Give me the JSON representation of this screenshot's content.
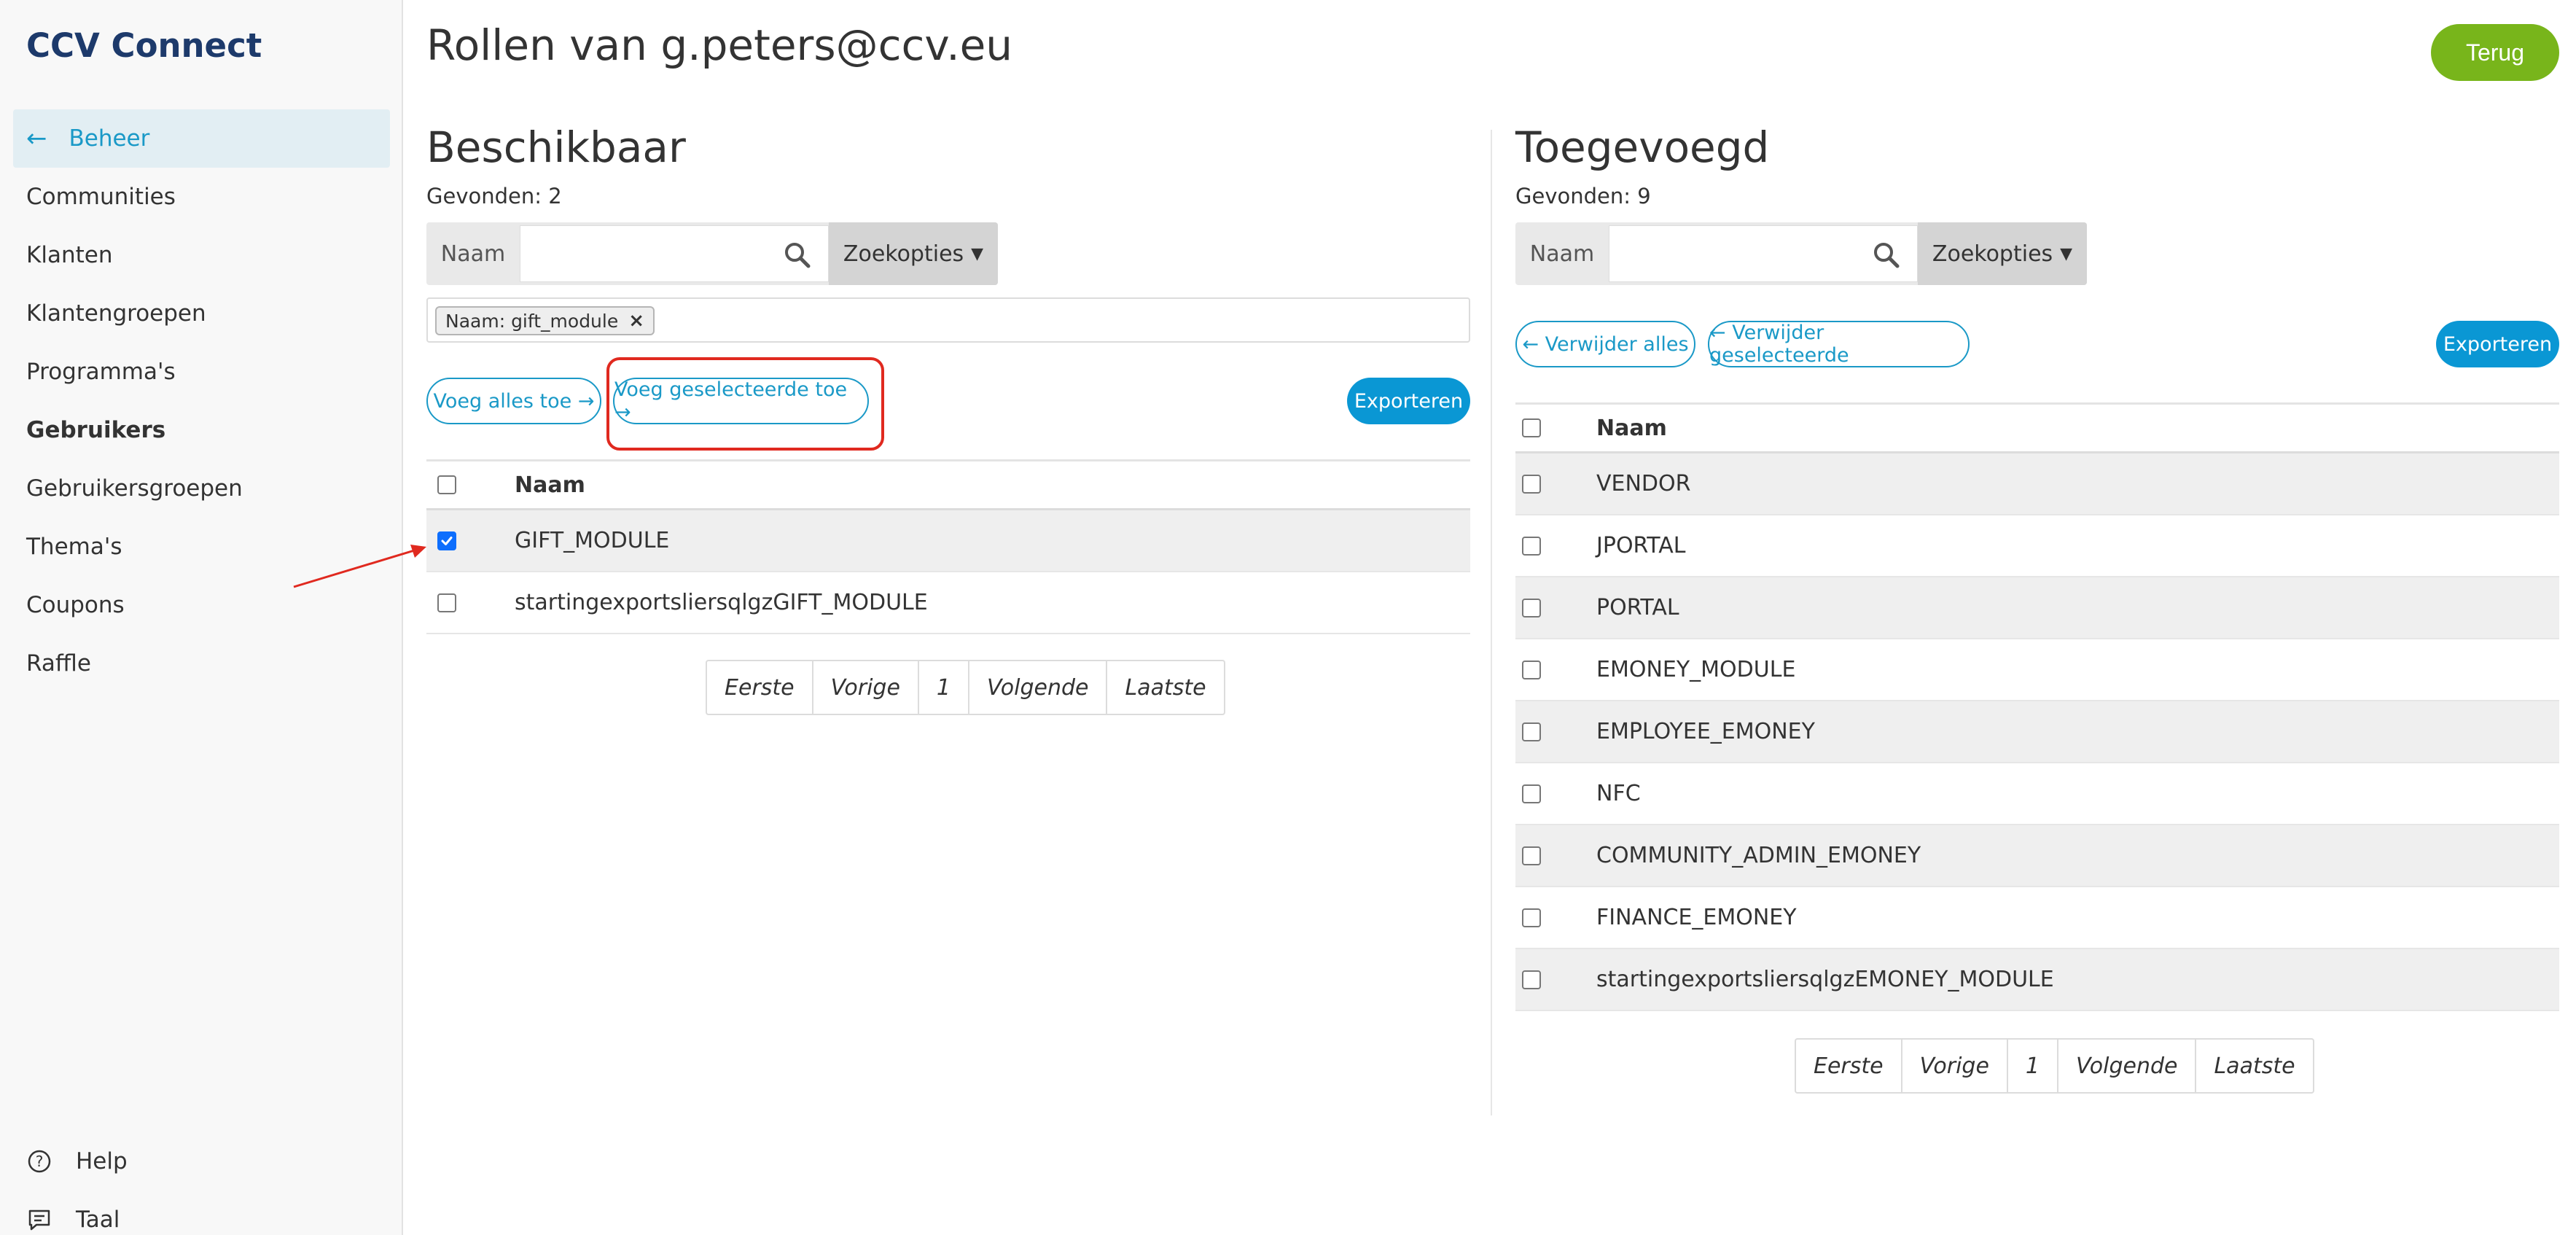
{
  "sidebar": {
    "brand": "CCV Connect",
    "active_item": "Beheer",
    "items": [
      "Communities",
      "Klanten",
      "Klantengroepen",
      "Programma's",
      "Gebruikers",
      "Gebruikersgroepen",
      "Thema's",
      "Coupons",
      "Raffle"
    ],
    "bold_item": "Gebruikers",
    "help": "Help",
    "language": "Taal"
  },
  "header": {
    "title": "Rollen van g.peters@ccv.eu",
    "back_label": "Terug"
  },
  "available": {
    "title": "Beschikbaar",
    "found": "Gevonden: 2",
    "search_label": "Naam",
    "search_placeholder": "",
    "search_options": "Zoekopties",
    "filter_chip": "Naam: gift_module",
    "add_all": "Voeg alles toe →",
    "add_selected": "Voeg geselecteerde toe →",
    "export": "Exporteren",
    "column": "Naam",
    "rows": [
      {
        "name": "GIFT_MODULE",
        "checked": true
      },
      {
        "name": "startingexportsliersqlgzGIFT_MODULE",
        "checked": false
      }
    ],
    "pager": [
      "Eerste",
      "Vorige",
      "1",
      "Volgende",
      "Laatste"
    ]
  },
  "added": {
    "title": "Toegevoegd",
    "found": "Gevonden: 9",
    "search_label": "Naam",
    "search_placeholder": "",
    "search_options": "Zoekopties",
    "remove_all": "← Verwijder alles",
    "remove_selected": "← Verwijder geselecteerde",
    "export": "Exporteren",
    "column": "Naam",
    "rows": [
      {
        "name": "VENDOR"
      },
      {
        "name": "JPORTAL"
      },
      {
        "name": "PORTAL"
      },
      {
        "name": "EMONEY_MODULE"
      },
      {
        "name": "EMPLOYEE_EMONEY"
      },
      {
        "name": "NFC"
      },
      {
        "name": "COMMUNITY_ADMIN_EMONEY"
      },
      {
        "name": "FINANCE_EMONEY"
      },
      {
        "name": "startingexportsliersqlgzEMONEY_MODULE"
      }
    ],
    "pager": [
      "Eerste",
      "Vorige",
      "1",
      "Volgende",
      "Laatste"
    ]
  },
  "colors": {
    "accent": "#1a99c7",
    "primary": "#0a97d4",
    "back_button": "#78b51b",
    "highlight": "#e0291f",
    "brand": "#1d3a6b"
  }
}
